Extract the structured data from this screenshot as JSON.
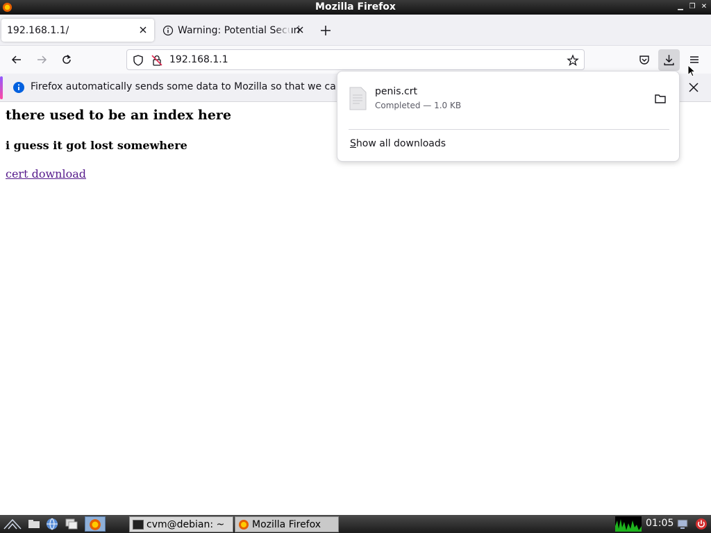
{
  "window": {
    "title": "Mozilla Firefox"
  },
  "tabs": [
    {
      "label": "192.168.1.1/",
      "active": true
    },
    {
      "label": "Warning: Potential Securi",
      "active": false
    }
  ],
  "navbar": {
    "url": "192.168.1.1"
  },
  "notification": {
    "message": "Firefox automatically sends some data to Mozilla so that we can im"
  },
  "page": {
    "heading1": "there used to be an index here",
    "heading2": "i guess it got lost somewhere",
    "link": "cert download"
  },
  "downloads_panel": {
    "file_name": "penis.crt",
    "status": "Completed — 1.0 KB",
    "show_all_label_first": "S",
    "show_all_label_rest": "how all downloads"
  },
  "taskbar": {
    "tasks": [
      {
        "label": "cvm@debian: ~"
      },
      {
        "label": "Mozilla Firefox"
      }
    ],
    "clock": "01:05"
  },
  "colors": {
    "accent_purple": "#9059ff",
    "accent_pink": "#ff4aa2",
    "info_blue": "#0060df",
    "link_visited": "#551a8b"
  }
}
